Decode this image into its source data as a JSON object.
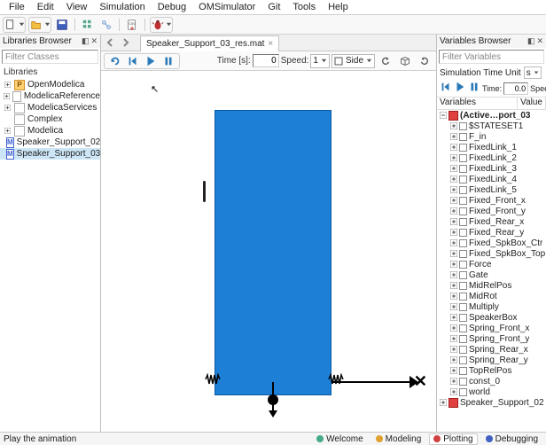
{
  "menu": [
    "File",
    "Edit",
    "View",
    "Simulation",
    "Debug",
    "OMSimulator",
    "Git",
    "Tools",
    "Help"
  ],
  "panels": {
    "libraries": {
      "title": "Libraries Browser",
      "filter_placeholder": "Filter Classes",
      "section": "Libraries"
    },
    "variables": {
      "title": "Variables Browser",
      "filter_placeholder": "Filter Variables"
    }
  },
  "library_tree": [
    {
      "label": "OpenModelica",
      "icon": "P"
    },
    {
      "label": "ModelicaReference",
      "icon": "white"
    },
    {
      "label": "ModelicaServices",
      "icon": "white"
    },
    {
      "label": "Complex",
      "icon": "white"
    },
    {
      "label": "Modelica",
      "icon": "white"
    },
    {
      "label": "Speaker_Support_02",
      "icon": "M"
    },
    {
      "label": "Speaker_Support_03",
      "icon": "M",
      "selected": true
    }
  ],
  "tab": {
    "label": "Speaker_Support_03_res.mat"
  },
  "playbar": {
    "time_label": "Time [s]:",
    "time_value": "0",
    "speed_label": "Speed:",
    "speed_value": "1",
    "side_label": "Side"
  },
  "sim_unit": {
    "label": "Simulation Time Unit",
    "value": "s"
  },
  "mini": {
    "time_label": "Time:",
    "time_value": "0.0",
    "speed_label": "Speed:"
  },
  "var_headers": {
    "c1": "Variables",
    "c2": "Value"
  },
  "var_root": "(Active…port_03",
  "variables": [
    "$STATESET1",
    "F_in",
    "FixedLink_1",
    "FixedLink_2",
    "FixedLink_3",
    "FixedLink_4",
    "FixedLink_5",
    "Fixed_Front_x",
    "Fixed_Front_y",
    "Fixed_Rear_x",
    "Fixed_Rear_y",
    "Fixed_SpkBox_Ctr",
    "Fixed_SpkBox_Top",
    "Force",
    "Gate",
    "MidRelPos",
    "MidRot",
    "Multiply",
    "SpeakerBox",
    "Spring_Front_x",
    "Spring_Front_y",
    "Spring_Rear_x",
    "Spring_Rear_y",
    "TopRelPos",
    "const_0",
    "world"
  ],
  "var_sibling": "Speaker_Support_02",
  "status": {
    "msg": "Play the animation",
    "tabs": [
      "Welcome",
      "Modeling",
      "Plotting",
      "Debugging"
    ]
  }
}
